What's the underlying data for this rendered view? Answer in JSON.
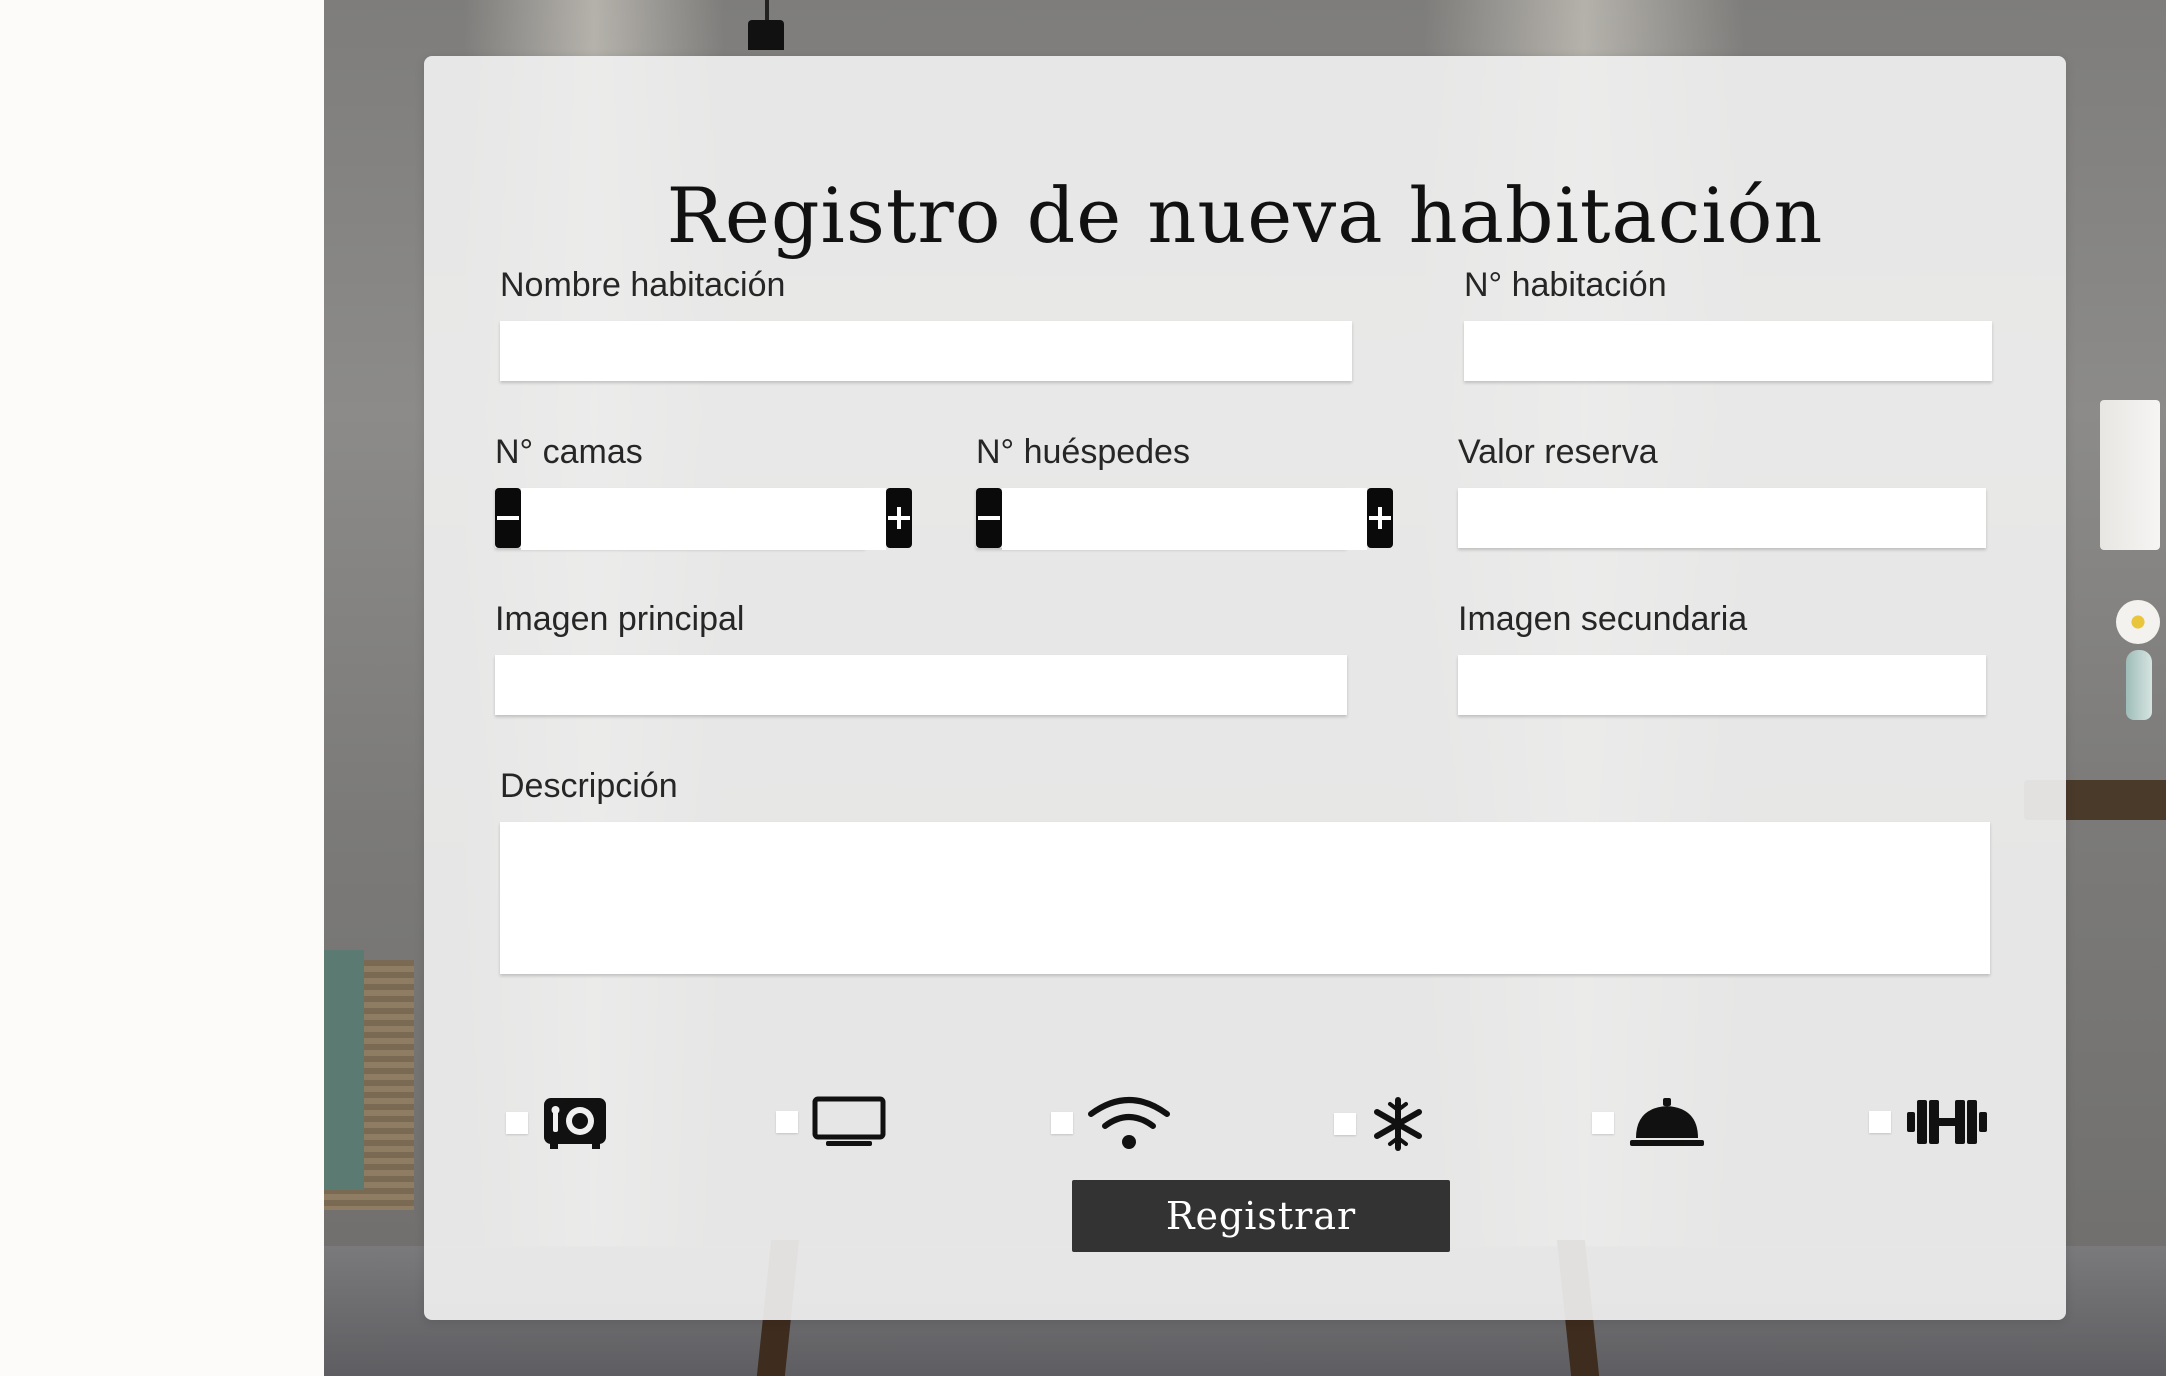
{
  "form": {
    "title": "Registro de nueva habitación",
    "fields": {
      "nombre": {
        "label": "Nombre habitación",
        "value": ""
      },
      "numero": {
        "label": "N° habitación",
        "value": ""
      },
      "camas": {
        "label": "N° camas",
        "value": ""
      },
      "huespedes": {
        "label": "N° huéspedes",
        "value": ""
      },
      "valor": {
        "label": "Valor reserva",
        "value": ""
      },
      "imagen_principal": {
        "label": "Imagen principal",
        "value": ""
      },
      "imagen_secundaria": {
        "label": "Imagen secundaria",
        "value": ""
      },
      "descripcion": {
        "label": "Descripción",
        "value": ""
      }
    },
    "amenities": [
      {
        "icon": "safe-icon",
        "checked": false
      },
      {
        "icon": "tv-icon",
        "checked": false
      },
      {
        "icon": "wifi-icon",
        "checked": false
      },
      {
        "icon": "snowflake-icon",
        "checked": false
      },
      {
        "icon": "service-bell-icon",
        "checked": false
      },
      {
        "icon": "dumbbell-icon",
        "checked": false
      }
    ],
    "submit_label": "Registrar"
  },
  "colors": {
    "card_bg": "#f0f0f0",
    "button_dark": "#333333",
    "stepper_btn": "#0a0a0a"
  }
}
